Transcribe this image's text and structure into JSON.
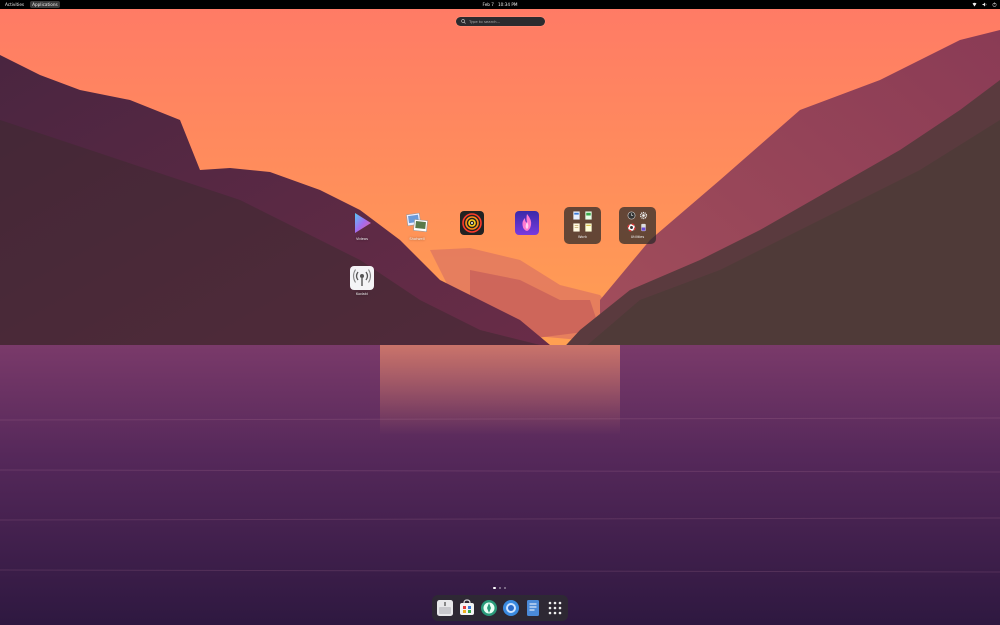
{
  "topbar": {
    "activities": "Activities",
    "applications": "Applications",
    "date": "Feb 7",
    "time": "10:34 PM",
    "icons": [
      "network-icon",
      "volume-icon",
      "power-icon"
    ]
  },
  "search": {
    "placeholder": "Type to search..."
  },
  "apps": [
    {
      "name": "videos",
      "label": "Videos",
      "icon": "videos-play-icon"
    },
    {
      "name": "shotwell",
      "label": "Shotwell",
      "icon": "photos-stack-icon"
    },
    {
      "name": "app-3",
      "label": "",
      "icon": "radar-rings-icon"
    },
    {
      "name": "app-4",
      "label": "",
      "icon": "flame-app-icon"
    },
    {
      "name": "kooha",
      "label": "Kodaki",
      "icon": "broadcast-icon"
    }
  ],
  "folders": [
    {
      "name": "work",
      "label": "Work",
      "icons": [
        "document-icon",
        "spreadsheet-icon",
        "text-document-icon",
        "notes-icon"
      ]
    },
    {
      "name": "utilities",
      "label": "Utilities",
      "icons": [
        "clock-icon",
        "gear-icon",
        "help-lifebuoy-icon",
        "usb-drive-icon"
      ]
    }
  ],
  "pager": {
    "pages": 3,
    "current": 1
  },
  "dock": [
    "files-icon",
    "software-store-icon",
    "app-green-icon",
    "web-browser-icon",
    "text-editor-icon",
    "show-apps-grid-icon"
  ],
  "colors": {
    "sky_top": "#ff7e6a",
    "sky_bottom": "#ffb25a",
    "mountain": "#6a2b4a",
    "water": "#4a2448",
    "topbar": "#000000"
  }
}
